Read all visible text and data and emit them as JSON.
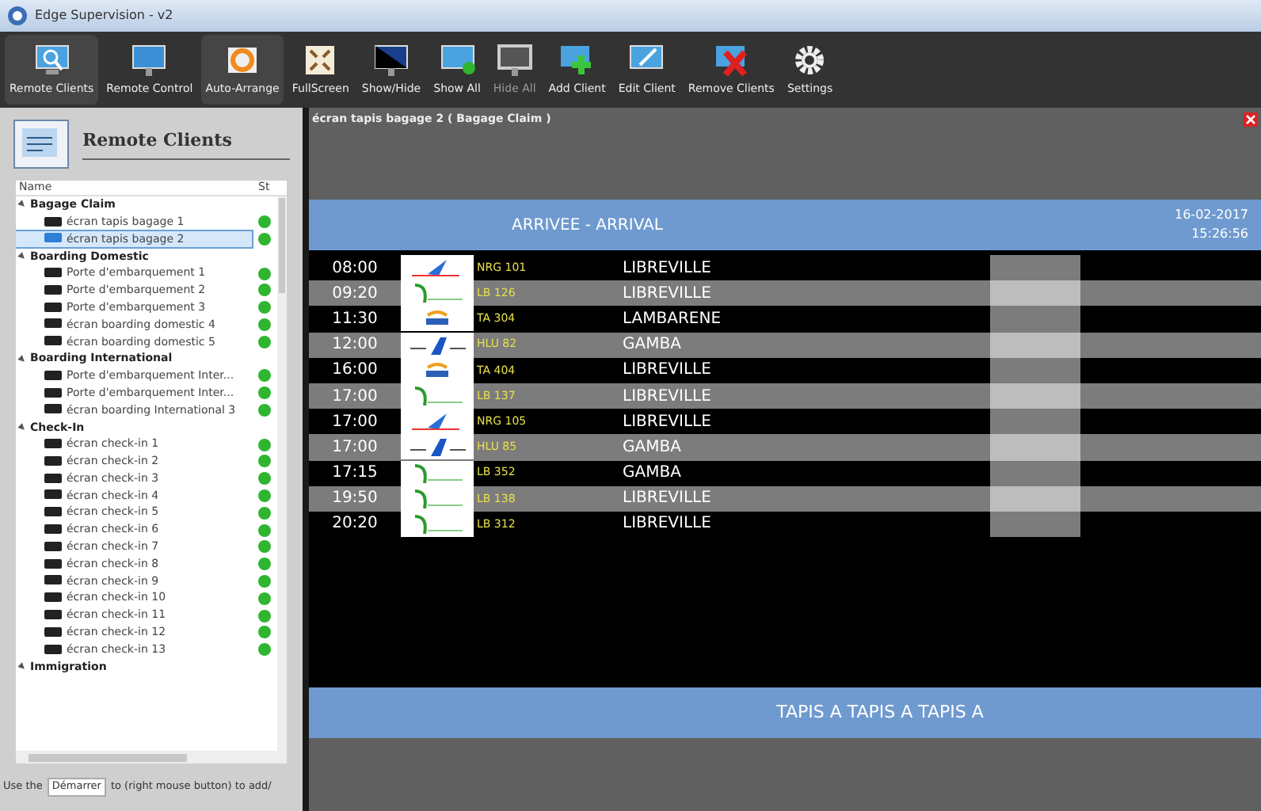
{
  "window": {
    "title": "Edge Supervision - v2"
  },
  "toolbar": [
    {
      "label": "Remote Clients",
      "active": true,
      "disabled": false
    },
    {
      "label": "Remote Control",
      "active": false,
      "disabled": false
    },
    {
      "label": "Auto-Arrange",
      "active": true,
      "disabled": false
    },
    {
      "label": "FullScreen",
      "active": false,
      "disabled": false
    },
    {
      "label": "Show/Hide",
      "active": false,
      "disabled": false
    },
    {
      "label": "Show All",
      "active": false,
      "disabled": false
    },
    {
      "label": "Hide All",
      "active": false,
      "disabled": true
    },
    {
      "label": "Add Client",
      "active": false,
      "disabled": false
    },
    {
      "label": "Edit Client",
      "active": false,
      "disabled": false
    },
    {
      "label": "Remove Clients",
      "active": false,
      "disabled": false
    },
    {
      "label": "Settings",
      "active": false,
      "disabled": false
    }
  ],
  "sidebar": {
    "title": "Remote Clients",
    "columns": [
      "Name",
      "St"
    ],
    "groups": [
      {
        "name": "Bagage Claim",
        "expanded": true,
        "children": [
          {
            "name": "écran tapis bagage 1",
            "selected": false,
            "color": "#2fb52f"
          },
          {
            "name": "écran tapis bagage 2",
            "selected": true,
            "color": "#2fb52f"
          }
        ]
      },
      {
        "name": "Boarding Domestic",
        "expanded": true,
        "children": [
          {
            "name": "Porte d'embarquement 1",
            "selected": false,
            "color": "#2fb52f"
          },
          {
            "name": "Porte d'embarquement 2",
            "selected": false,
            "color": "#2fb52f"
          },
          {
            "name": "Porte d'embarquement 3",
            "selected": false,
            "color": "#2fb52f"
          },
          {
            "name": "écran boarding domestic 4",
            "selected": false,
            "color": "#2fb52f"
          },
          {
            "name": "écran boarding domestic 5",
            "selected": false,
            "color": "#2fb52f"
          }
        ]
      },
      {
        "name": "Boarding International",
        "expanded": true,
        "children": [
          {
            "name": "Porte d'embarquement Inter...",
            "selected": false,
            "color": "#2fb52f"
          },
          {
            "name": "Porte d'embarquement Inter...",
            "selected": false,
            "color": "#2fb52f"
          },
          {
            "name": "écran boarding International 3",
            "selected": false,
            "color": "#2fb52f"
          }
        ]
      },
      {
        "name": "Check-In",
        "expanded": true,
        "children": [
          {
            "name": "écran check-in 1",
            "selected": false,
            "color": "#2fb52f"
          },
          {
            "name": "écran check-in 2",
            "selected": false,
            "color": "#2fb52f"
          },
          {
            "name": "écran check-in 3",
            "selected": false,
            "color": "#2fb52f"
          },
          {
            "name": "écran check-in 4",
            "selected": false,
            "color": "#2fb52f"
          },
          {
            "name": "écran check-in 5",
            "selected": false,
            "color": "#2fb52f"
          },
          {
            "name": "écran check-in 6",
            "selected": false,
            "color": "#2fb52f"
          },
          {
            "name": "écran check-in 7",
            "selected": false,
            "color": "#2fb52f"
          },
          {
            "name": "écran check-in 8",
            "selected": false,
            "color": "#2fb52f"
          },
          {
            "name": "écran check-in 9",
            "selected": false,
            "color": "#2fb52f"
          },
          {
            "name": "écran check-in 10",
            "selected": false,
            "color": "#2fb52f"
          },
          {
            "name": "écran check-in 11",
            "selected": false,
            "color": "#2fb52f"
          },
          {
            "name": "écran check-in 12",
            "selected": false,
            "color": "#2fb52f"
          },
          {
            "name": "écran check-in 13",
            "selected": false,
            "color": "#2fb52f"
          }
        ]
      },
      {
        "name": "Immigration",
        "expanded": true
      }
    ],
    "hint": {
      "before": "Use the",
      "field": "Démarrer",
      "after": "to (right mouse button) to add/"
    }
  },
  "viewer": {
    "title": "écran tapis bagage 2 ( Bagage Claim )",
    "board": {
      "heading": "ARRIVEE - ARRIVAL",
      "date": "16-02-2017",
      "time": "15:26:56",
      "rows": [
        {
          "time": "08:00",
          "kind": "plane",
          "flight": "NRG 101",
          "destination": "LIBREVILLE"
        },
        {
          "time": "09:20",
          "kind": "swoosh",
          "flight": "LB 126",
          "destination": "LIBREVILLE"
        },
        {
          "time": "11:30",
          "kind": "bird",
          "flight": "TA 304",
          "destination": "LAMBARENE"
        },
        {
          "time": "12:00",
          "kind": "wing",
          "flight": "HLU 82",
          "destination": "GAMBA"
        },
        {
          "time": "16:00",
          "kind": "bird",
          "flight": "TA 404",
          "destination": "LIBREVILLE"
        },
        {
          "time": "17:00",
          "kind": "swoosh",
          "flight": "LB 137",
          "destination": "LIBREVILLE"
        },
        {
          "time": "17:00",
          "kind": "plane",
          "flight": "NRG 105",
          "destination": "LIBREVILLE"
        },
        {
          "time": "17:00",
          "kind": "wing",
          "flight": "HLU 85",
          "destination": "GAMBA"
        },
        {
          "time": "17:15",
          "kind": "swoosh",
          "flight": "LB 352",
          "destination": "GAMBA"
        },
        {
          "time": "19:50",
          "kind": "swoosh",
          "flight": "LB 138",
          "destination": "LIBREVILLE"
        },
        {
          "time": "20:20",
          "kind": "swoosh",
          "flight": "LB 312",
          "destination": "LIBREVILLE"
        }
      ],
      "ticker": "TAPIS A TAPIS A TAPIS A"
    }
  }
}
